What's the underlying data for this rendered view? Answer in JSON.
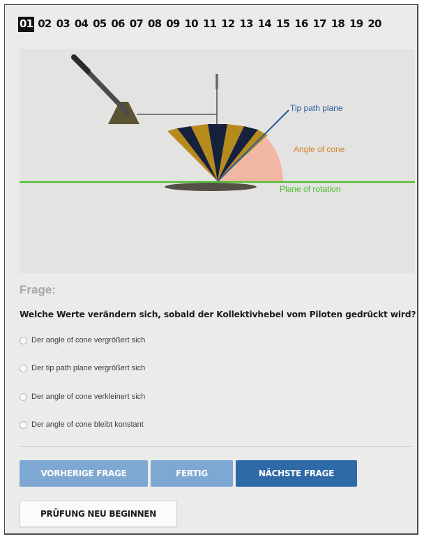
{
  "question_nav": [
    "01",
    "02",
    "03",
    "04",
    "05",
    "06",
    "07",
    "08",
    "09",
    "10",
    "11",
    "12",
    "13",
    "14",
    "15",
    "16",
    "17",
    "18",
    "19",
    "20"
  ],
  "active_question": "01",
  "figure": {
    "labels": {
      "tip_path_plane": "Tip path plane",
      "angle_of_cone": "Angle of cone",
      "plane_of_rotation": "Plane of rotation"
    },
    "colors": {
      "tip_path_plane": "#2e5d9e",
      "angle_of_cone": "#d4852e",
      "plane_of_rotation": "#4dbb2c",
      "cone_angle_fill": "#f2b7a4",
      "blade_gold": "#b78a1c",
      "blade_navy": "#16213d"
    }
  },
  "frage_label": "Frage:",
  "question_text": "Welche Werte verändern sich, sobald der Kollektivhebel vom Piloten gedrückt wird?",
  "options": [
    "Der angle of cone vergrößert sich",
    "Der tip path plane vergrößert sich",
    "Der angle of cone verkleinert sich",
    "Der angle of cone bleibt konstant"
  ],
  "buttons": {
    "previous": "VORHERIGE FRAGE",
    "done": "FERTIG",
    "next": "NÄCHSTE FRAGE",
    "restart": "PRÜFUNG NEU BEGINNEN"
  },
  "colors": {
    "button_light": "#7ea8d2",
    "button_dark": "#2f6aa8",
    "background": "#ebebe9"
  }
}
